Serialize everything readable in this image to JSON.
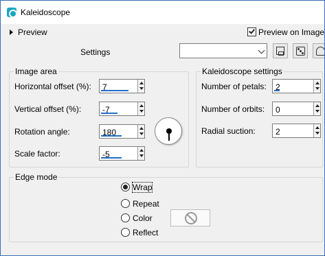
{
  "window": {
    "title": "Kaleidoscope"
  },
  "preview": {
    "toggle_label": "Preview",
    "preview_on_image_label": "Preview on Image",
    "preview_on_image_checked": true
  },
  "settings": {
    "label": "Settings",
    "preset_value": ""
  },
  "image_area": {
    "title": "Image area",
    "horizontal_offset": {
      "label": "Horizontal offset (%):",
      "value": "7"
    },
    "vertical_offset": {
      "label": "Vertical offset (%):",
      "value": "-7"
    },
    "rotation_angle": {
      "label": "Rotation angle:",
      "value": "180"
    },
    "scale_factor": {
      "label": "Scale factor:",
      "value": "-5"
    }
  },
  "kaleidoscope_settings": {
    "title": "Kaleidoscope settings",
    "number_of_petals": {
      "label": "Number of petals:",
      "value": "2"
    },
    "number_of_orbits": {
      "label": "Number of orbits:",
      "value": "0"
    },
    "radial_suction": {
      "label": "Radial suction:",
      "value": "2"
    }
  },
  "edge_mode": {
    "title": "Edge mode",
    "options": [
      "Wrap",
      "Repeat",
      "Color",
      "Reflect"
    ],
    "selected": "Wrap"
  },
  "icons": [
    "kaleidoscope-app-icon",
    "save-icon",
    "randomize-icon",
    "reset-icon",
    "dial-icon",
    "no-color-icon"
  ]
}
